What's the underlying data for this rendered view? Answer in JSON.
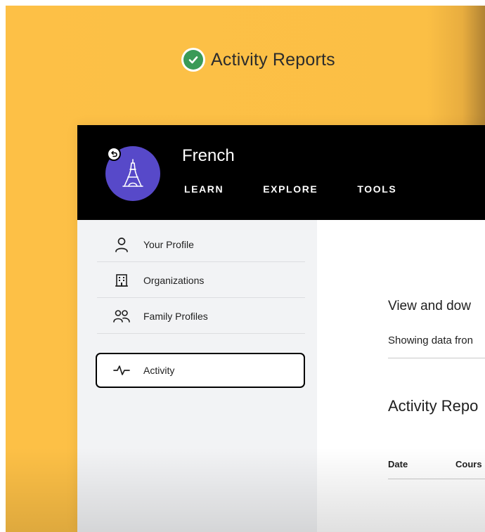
{
  "banner": {
    "title": "Activity Reports",
    "icon": "check-circle-icon",
    "check_color": "#3a9a57"
  },
  "header": {
    "course_name": "French",
    "avatar_icon": "eiffel-tower-icon",
    "avatar_color": "#5749c9",
    "badge_icon": "undo-icon",
    "nav": [
      "LEARN",
      "EXPLORE",
      "TOOLS"
    ]
  },
  "sidebar": {
    "items": [
      {
        "label": "Your Profile",
        "icon": "person-icon"
      },
      {
        "label": "Organizations",
        "icon": "building-icon"
      },
      {
        "label": "Family Profiles",
        "icon": "family-icon"
      },
      {
        "label": "Activity",
        "icon": "activity-pulse-icon",
        "active": true
      }
    ]
  },
  "main": {
    "heading": "View and dow",
    "showing": "Showing data fron",
    "reports_title": "Activity Repo",
    "table_headers": [
      "Date",
      "Cours"
    ]
  },
  "colors": {
    "background": "#fbbf45",
    "header": "#000000",
    "sidebar": "#f2f3f5"
  }
}
